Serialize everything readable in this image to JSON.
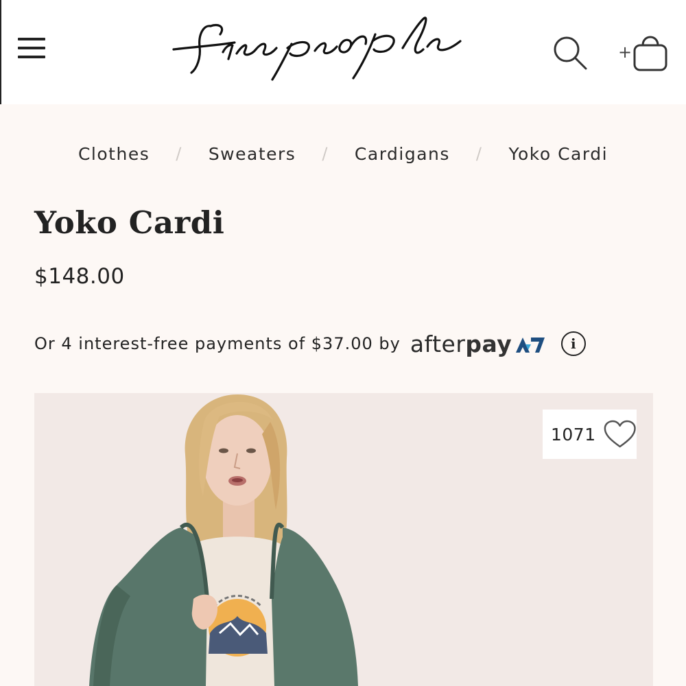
{
  "header": {
    "brand": "free people",
    "menu_icon": "hamburger-menu-icon",
    "search_icon": "search-icon",
    "bag_icon": "shopping-bag-icon",
    "bag_prefix": "+"
  },
  "breadcrumb": {
    "items": [
      "Clothes",
      "Sweaters",
      "Cardigans",
      "Yoko Cardi"
    ],
    "separator": "/"
  },
  "product": {
    "title": "Yoko Cardi",
    "price": "$148.00",
    "installment_text": "Or 4 interest-free payments of $37.00 by",
    "afterpay_brand_light": "after",
    "afterpay_brand_bold": "pay",
    "info_icon": "info-icon",
    "info_label": "i"
  },
  "favorites": {
    "count": "1071",
    "icon": "heart-icon"
  },
  "colors": {
    "page_background": "#fdf8f5",
    "header_background": "#ffffff",
    "text": "#222222",
    "afterpay_blue": "#1e4e80"
  }
}
